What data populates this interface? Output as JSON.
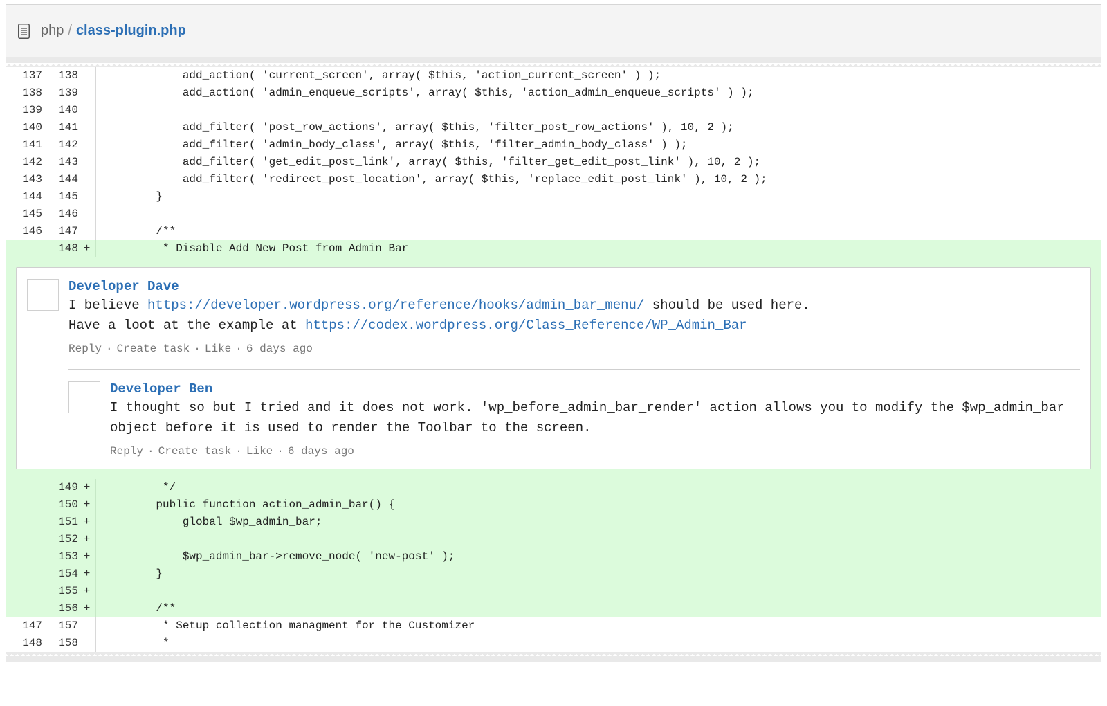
{
  "file": {
    "dir": "php",
    "separator": "/",
    "name": "class-plugin.php",
    "icon": "document-icon"
  },
  "context_lines": [
    {
      "old": "137",
      "new": "138",
      "marker": "",
      "code": "        add_action( 'current_screen', array( $this, 'action_current_screen' ) );"
    },
    {
      "old": "138",
      "new": "139",
      "marker": "",
      "code": "        add_action( 'admin_enqueue_scripts', array( $this, 'action_admin_enqueue_scripts' ) );"
    },
    {
      "old": "139",
      "new": "140",
      "marker": "",
      "code": ""
    },
    {
      "old": "140",
      "new": "141",
      "marker": "",
      "code": "        add_filter( 'post_row_actions', array( $this, 'filter_post_row_actions' ), 10, 2 );"
    },
    {
      "old": "141",
      "new": "142",
      "marker": "",
      "code": "        add_filter( 'admin_body_class', array( $this, 'filter_admin_body_class' ) );"
    },
    {
      "old": "142",
      "new": "143",
      "marker": "",
      "code": "        add_filter( 'get_edit_post_link', array( $this, 'filter_get_edit_post_link' ), 10, 2 );"
    },
    {
      "old": "143",
      "new": "144",
      "marker": "",
      "code": "        add_filter( 'redirect_post_location', array( $this, 'replace_edit_post_link' ), 10, 2 );"
    },
    {
      "old": "144",
      "new": "145",
      "marker": "",
      "code": "    }"
    },
    {
      "old": "145",
      "new": "146",
      "marker": "",
      "code": ""
    },
    {
      "old": "146",
      "new": "147",
      "marker": "",
      "code": "    /**"
    }
  ],
  "commented_line": {
    "old": "",
    "new": "148",
    "marker": "+",
    "code": "     * Disable Add New Post from Admin Bar"
  },
  "comments": {
    "first": {
      "author": "Developer Dave",
      "line1_pre": "I believe ",
      "line1_link": "https://developer.wordpress.org/reference/hooks/admin_bar_menu/",
      "line1_post": " should be used here.",
      "line2_pre": "Have a loot at the example at ",
      "line2_link": "https://codex.wordpress.org/Class_Reference/WP_Admin_Bar",
      "reply": "Reply",
      "create_task": "Create task",
      "like": "Like",
      "time": "6 days ago"
    },
    "reply": {
      "author": "Developer Ben",
      "text": "I thought so but I tried and it does not work. 'wp_before_admin_bar_render' action allows you to modify the $wp_admin_bar object before it is used to render the Toolbar to the screen.",
      "reply": "Reply",
      "create_task": "Create task",
      "like": "Like",
      "time": "6 days ago"
    },
    "meta_separator": "·"
  },
  "added_lines": [
    {
      "old": "",
      "new": "149",
      "marker": "+",
      "code": "     */"
    },
    {
      "old": "",
      "new": "150",
      "marker": "+",
      "code": "    public function action_admin_bar() {"
    },
    {
      "old": "",
      "new": "151",
      "marker": "+",
      "code": "        global $wp_admin_bar;"
    },
    {
      "old": "",
      "new": "152",
      "marker": "+",
      "code": ""
    },
    {
      "old": "",
      "new": "153",
      "marker": "+",
      "code": "        $wp_admin_bar->remove_node( 'new-post' );"
    },
    {
      "old": "",
      "new": "154",
      "marker": "+",
      "code": "    }"
    },
    {
      "old": "",
      "new": "155",
      "marker": "+",
      "code": ""
    },
    {
      "old": "",
      "new": "156",
      "marker": "+",
      "code": "    /**"
    }
  ],
  "trailing_lines": [
    {
      "old": "147",
      "new": "157",
      "marker": "",
      "code": "     * Setup collection managment for the Customizer"
    },
    {
      "old": "148",
      "new": "158",
      "marker": "",
      "code": "     *"
    }
  ],
  "colors": {
    "added_bg": "#dcfbdc",
    "link": "#2c6fb5",
    "meta": "#777777"
  }
}
